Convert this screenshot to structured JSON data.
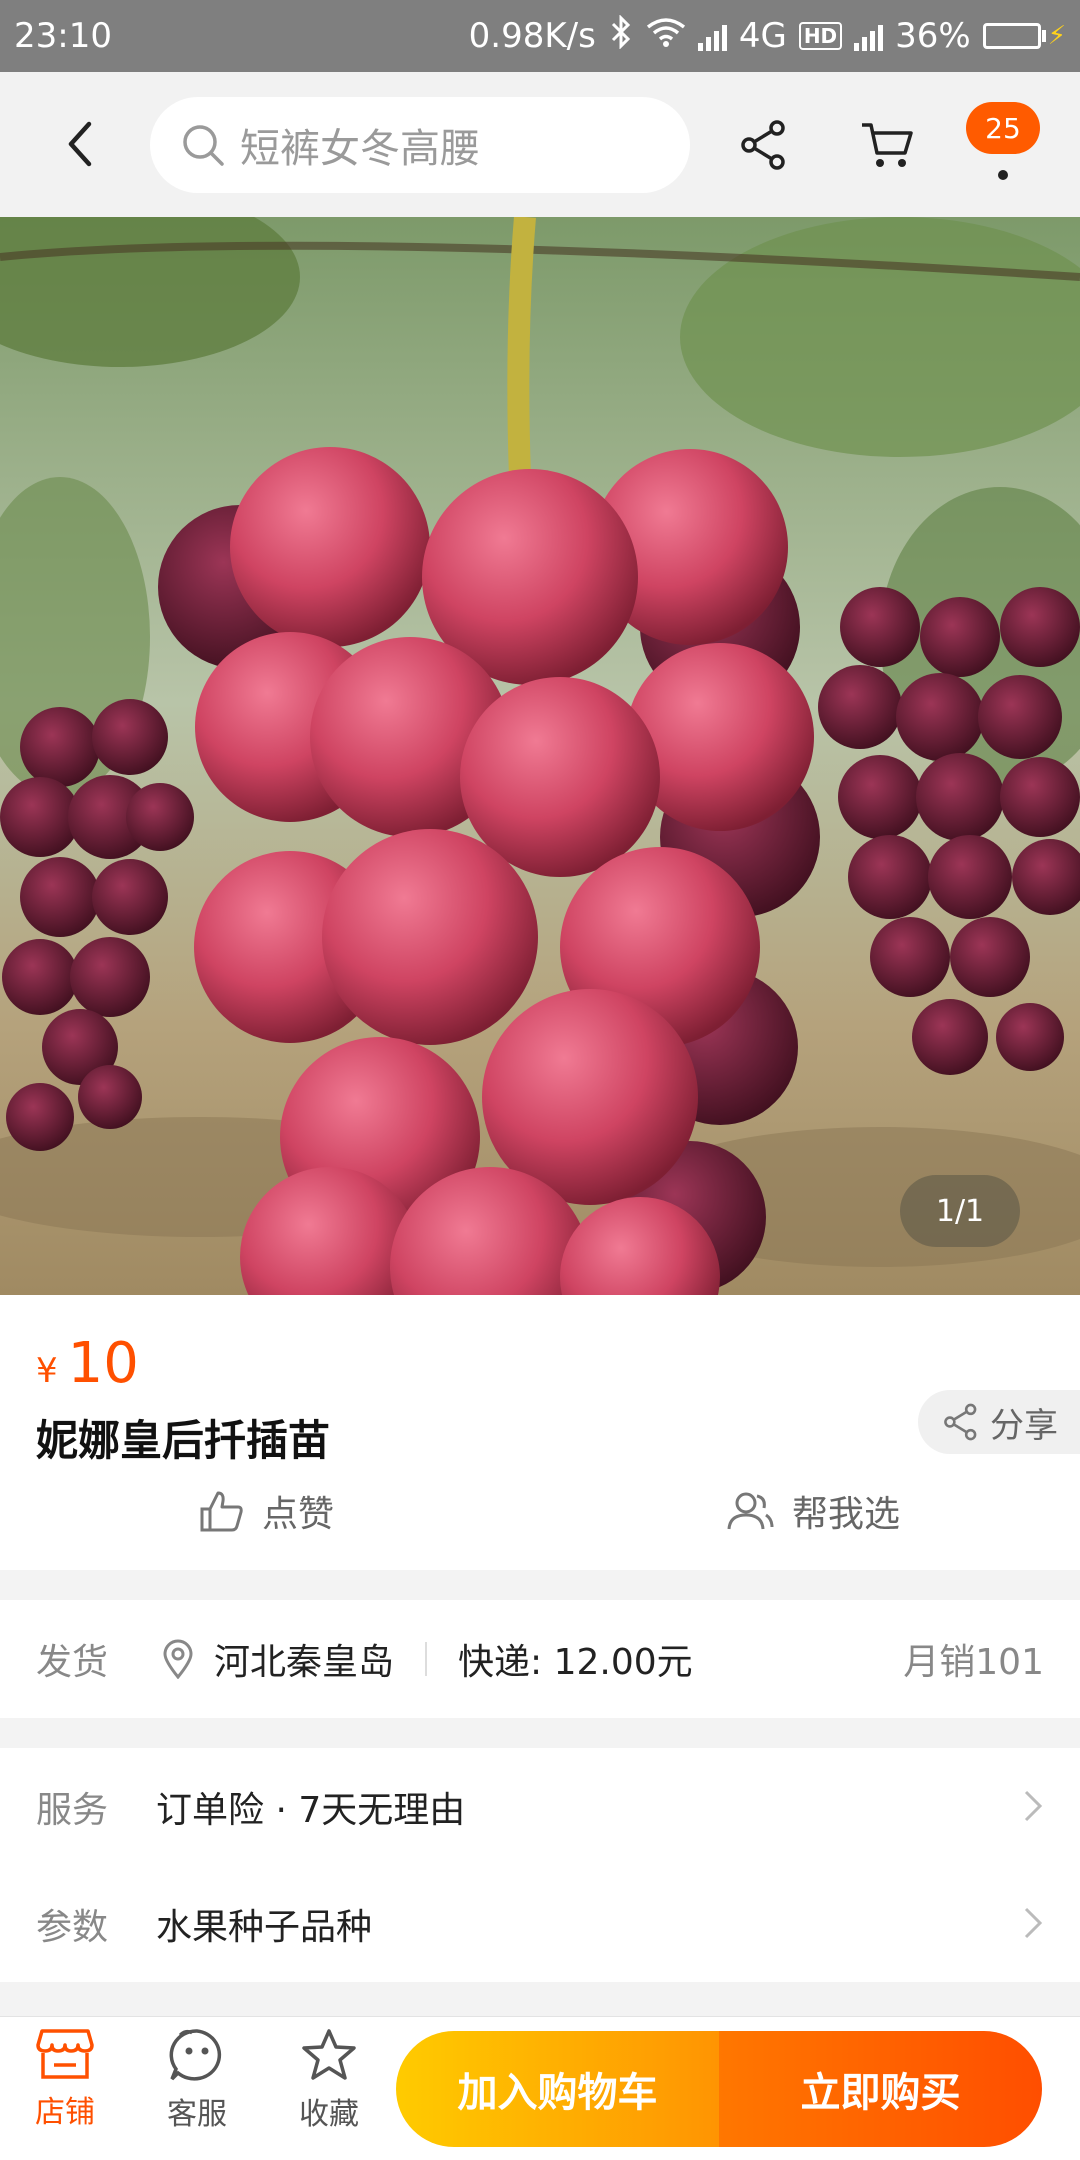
{
  "status_bar": {
    "time": "23:10",
    "net_speed": "0.98K/s",
    "network": "4G",
    "hd": "HD",
    "battery": "36%",
    "battery_level": 0.36
  },
  "header": {
    "search_placeholder": "短裤女冬高腰",
    "badge_count": "25"
  },
  "gallery": {
    "pager": "1/1"
  },
  "product": {
    "currency": "¥",
    "price": "10",
    "title": "妮娜皇后扦插苗",
    "share_label": "分享",
    "like_label": "点赞",
    "pick_label": "帮我选"
  },
  "shipping": {
    "label": "发货",
    "location": "河北秦皇岛",
    "express": "快递: 12.00元",
    "monthly_sales": "月销101"
  },
  "service": {
    "label": "服务",
    "value": "订单险 · 7天无理由"
  },
  "params": {
    "label": "参数",
    "value": "水果种子品种"
  },
  "bottom_bar": {
    "store": "店铺",
    "customer_service": "客服",
    "favorite": "收藏",
    "add_to_cart": "加入购物车",
    "buy_now": "立即购买"
  },
  "colors": {
    "accent": "#ff5000",
    "cart_gradient": [
      "#ffcb00",
      "#ff9402"
    ],
    "buy_gradient": [
      "#ff7700",
      "#ff4e00"
    ]
  }
}
